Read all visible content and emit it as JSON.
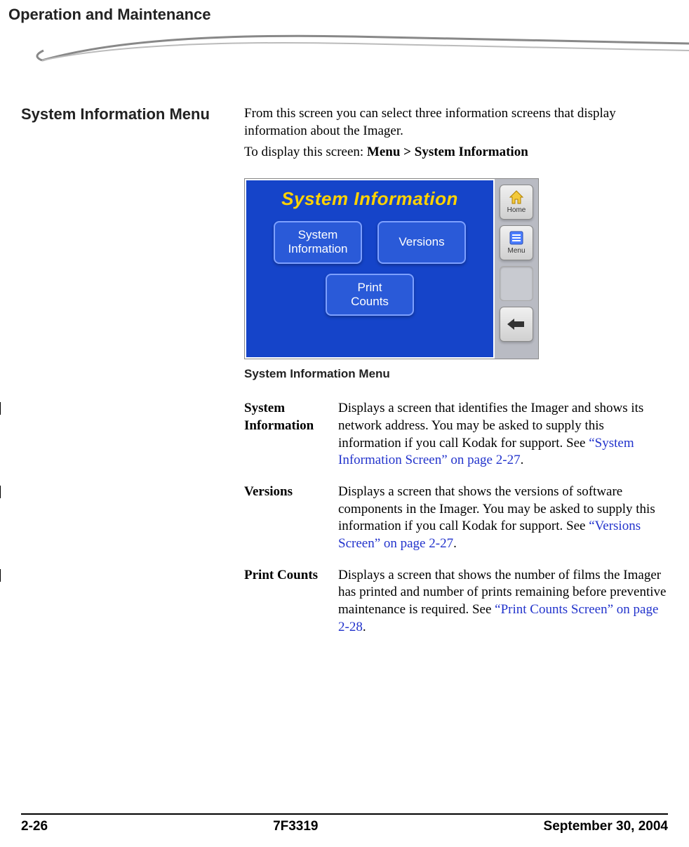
{
  "header": {
    "chapter_title": "Operation and Maintenance"
  },
  "section": {
    "heading": "System Information Menu",
    "intro": "From this screen you can select three information screens that display information about the Imager.",
    "nav_prefix": "To display this screen: ",
    "nav_path": "Menu > System Information"
  },
  "device_screen": {
    "title": "System Information",
    "buttons": {
      "sys_info_line1": "System",
      "sys_info_line2": "Information",
      "versions": "Versions",
      "print_line1": "Print",
      "print_line2": "Counts"
    },
    "side": {
      "home_label": "Home",
      "menu_label": "Menu"
    }
  },
  "figure_caption": "System Information Menu",
  "definitions": [
    {
      "term": "System Information",
      "desc_pre": "Displays a screen that identifies the Imager and shows its network address. You may be asked to supply this information if you call Kodak for support. See ",
      "xref": "“System Information Screen” on page 2-27",
      "desc_post": "."
    },
    {
      "term": "Versions",
      "desc_pre": "Displays a screen that shows the versions of software components in the Imager. You may be asked to supply this information if you call Kodak for support. See ",
      "xref": "“Versions Screen” on page 2-27",
      "desc_post": "."
    },
    {
      "term": "Print Counts",
      "desc_pre": "Displays a screen that shows the number of films the Imager has printed and number of prints remaining before preventive maintenance is required. See ",
      "xref": "“Print Counts Screen” on page 2-28",
      "desc_post": "."
    }
  ],
  "footer": {
    "page": "2-26",
    "doc_id": "7F3319",
    "date": "September 30, 2004"
  }
}
